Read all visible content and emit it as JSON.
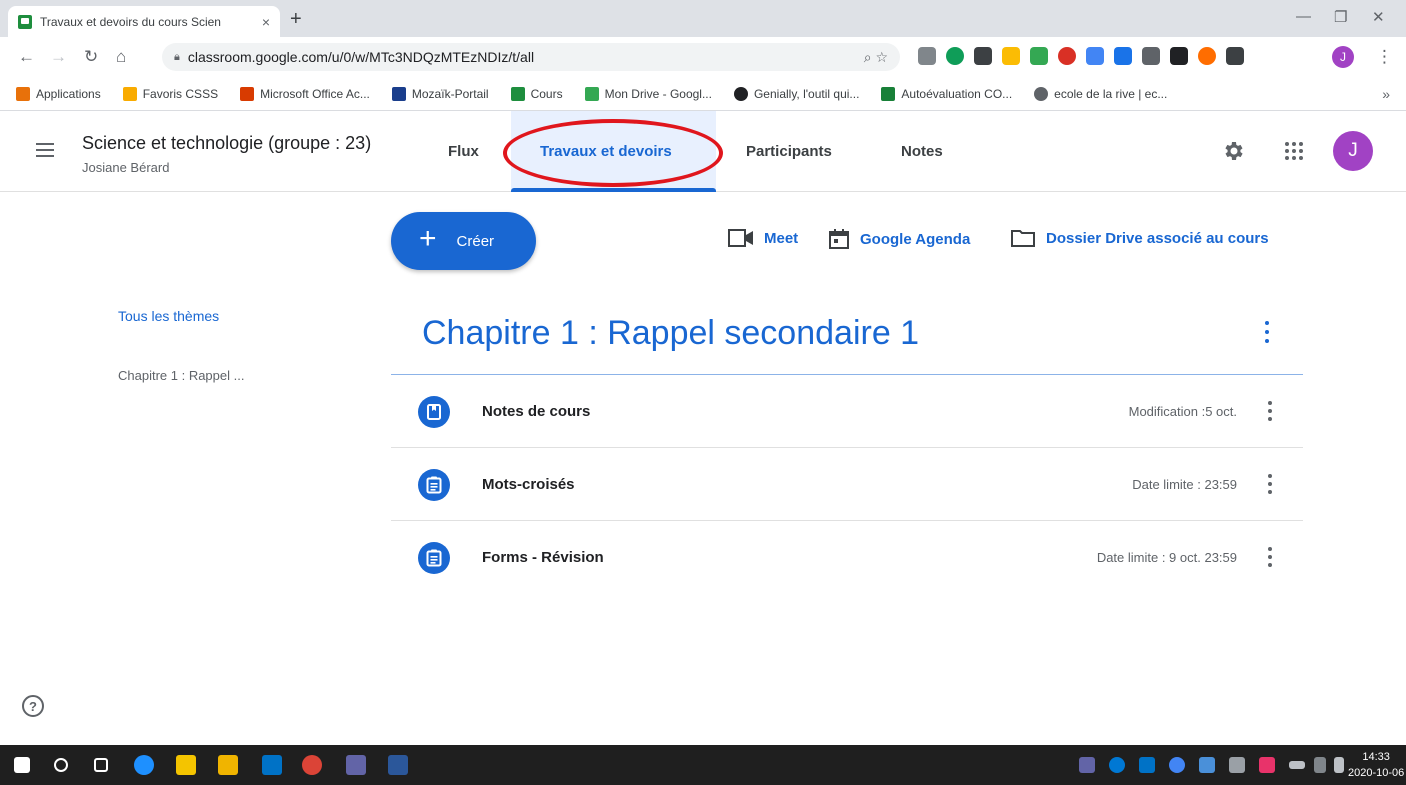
{
  "browser": {
    "tab_title": "Travaux et devoirs du cours Scien",
    "tab_close": "×",
    "new_tab": "+",
    "url": "classroom.google.com/u/0/w/MTc3NDQzMTEzNDIz/t/all",
    "profile_initial": "J",
    "window_minimize": "—",
    "window_restore": "❐",
    "window_close": "✕",
    "bookmarks_more": "»"
  },
  "bookmarks": [
    {
      "label": "Applications",
      "color": "#e8710a"
    },
    {
      "label": "Favoris CSSS",
      "color": "#f9ab00"
    },
    {
      "label": "Microsoft Office Ac...",
      "color": "#d83b01"
    },
    {
      "label": "Mozaïk-Portail",
      "color": "#1a3e8c"
    },
    {
      "label": "Cours",
      "color": "#1e8e3e"
    },
    {
      "label": "Mon Drive - Googl...",
      "color": "#34a853"
    },
    {
      "label": "Genially, l'outil qui...",
      "color": "#202124"
    },
    {
      "label": "Autoévaluation CO...",
      "color": "#188038"
    },
    {
      "label": "ecole de la rive | ec...",
      "color": "#5f6368"
    }
  ],
  "header": {
    "course_title": "Science et technologie (groupe : 23)",
    "teacher": "Josiane Bérard",
    "tabs": [
      {
        "label": "Flux"
      },
      {
        "label": "Travaux et devoirs"
      },
      {
        "label": "Participants"
      },
      {
        "label": "Notes"
      }
    ],
    "avatar_initial": "J"
  },
  "toolbar": {
    "create_label": "Créer",
    "create_plus": "+",
    "meet_label": "Meet",
    "agenda_label": "Google Agenda",
    "drive_label": "Dossier Drive associé au cours"
  },
  "sidebar": {
    "all_topics": "Tous les thèmes",
    "items": [
      {
        "label": "Chapitre 1 : Rappel ..."
      }
    ]
  },
  "chapter": {
    "title": "Chapitre 1 : Rappel secondaire 1",
    "items": [
      {
        "label": "Notes de cours",
        "meta": "Modification :5 oct.",
        "icon": "material-icon"
      },
      {
        "label": "Mots-croisés",
        "meta": "Date limite : 23:59",
        "icon": "assignment-icon"
      },
      {
        "label": "Forms - Révision",
        "meta": "Date limite : 9 oct. 23:59",
        "icon": "assignment-icon"
      }
    ]
  },
  "help": {
    "label": "?"
  },
  "taskbar": {
    "time": "14:33",
    "date": "2020-10-06"
  },
  "colors": {
    "accent": "#1967d2",
    "annotation_circle": "#e0161d",
    "avatar": "#a142c4"
  }
}
